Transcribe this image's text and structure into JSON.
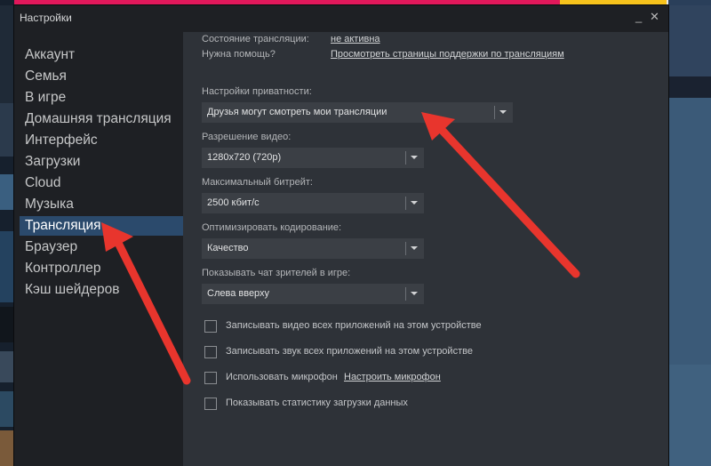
{
  "window": {
    "title": "Настройки",
    "minimize_glyph": "_",
    "close_glyph": "✕"
  },
  "sidebar": {
    "items": [
      {
        "label": "Аккаунт"
      },
      {
        "label": "Семья"
      },
      {
        "label": "В игре"
      },
      {
        "label": "Домашняя трансляция"
      },
      {
        "label": "Интерфейс"
      },
      {
        "label": "Загрузки"
      },
      {
        "label": "Cloud"
      },
      {
        "label": "Музыка"
      },
      {
        "label": "Трансляция",
        "selected": true
      },
      {
        "label": "Браузер"
      },
      {
        "label": "Контроллер"
      },
      {
        "label": "Кэш шейдеров"
      }
    ]
  },
  "broadcast": {
    "status_label": "Состояние трансляции:",
    "status_value": "не активна",
    "help_label": "Нужна помощь?",
    "help_link": "Просмотреть страницы поддержки по трансляциям",
    "privacy": {
      "label": "Настройки приватности:",
      "value": "Друзья могут смотреть мои трансляции"
    },
    "resolution": {
      "label": "Разрешение видео:",
      "value": "1280x720 (720p)"
    },
    "bitrate": {
      "label": "Максимальный битрейт:",
      "value": "2500 кбит/с"
    },
    "encoding": {
      "label": "Оптимизировать кодирование:",
      "value": "Качество"
    },
    "chat": {
      "label": "Показывать чат зрителей в игре:",
      "value": "Слева вверху"
    },
    "checkboxes": [
      {
        "label": "Записывать видео всех приложений на этом устройстве",
        "checked": false
      },
      {
        "label": "Записывать звук всех приложений на этом устройстве",
        "checked": false
      },
      {
        "label": "Использовать микрофон",
        "checked": false
      },
      {
        "label": "Показывать статистику загрузки данных",
        "checked": false
      }
    ],
    "mic_link": "Настроить микрофон"
  },
  "annotation_color": "#e8352d",
  "icons": {
    "dropdown": "chevron-down-icon",
    "close": "close-icon",
    "minimize": "minimize-icon",
    "annotation": "red-arrow-icon"
  }
}
